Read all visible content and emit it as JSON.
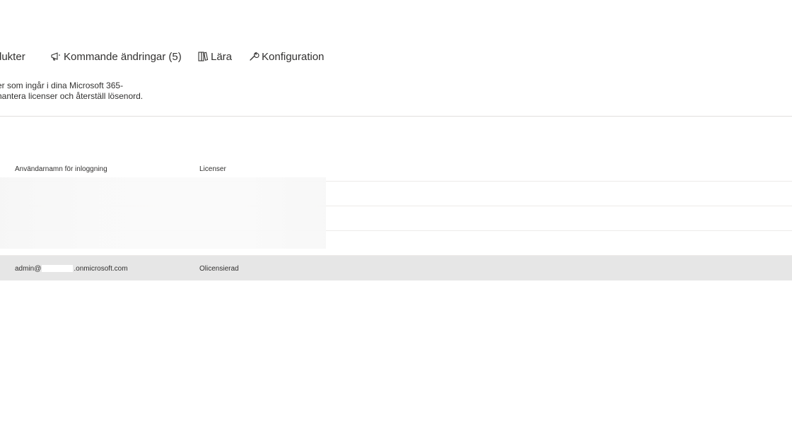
{
  "tabs": [
    {
      "label": "dukter",
      "icon": ""
    },
    {
      "label": "Kommande ändringar (5)",
      "icon": "megaphone-icon"
    },
    {
      "label": "Lära",
      "icon": "book-icon"
    },
    {
      "label": "Konfiguration",
      "icon": "wrench-icon"
    }
  ],
  "description": {
    "line1": "er som ingår i dina Microsoft 365-",
    "line2": "hantera licenser och återställ lösenord."
  },
  "table": {
    "columns": [
      "Användarnamn för inloggning",
      "Licenser"
    ],
    "selected_row": {
      "user_prefix": "admin@",
      "user_suffix": ".onmicrosoft.com",
      "license": "Olicensierad"
    }
  }
}
